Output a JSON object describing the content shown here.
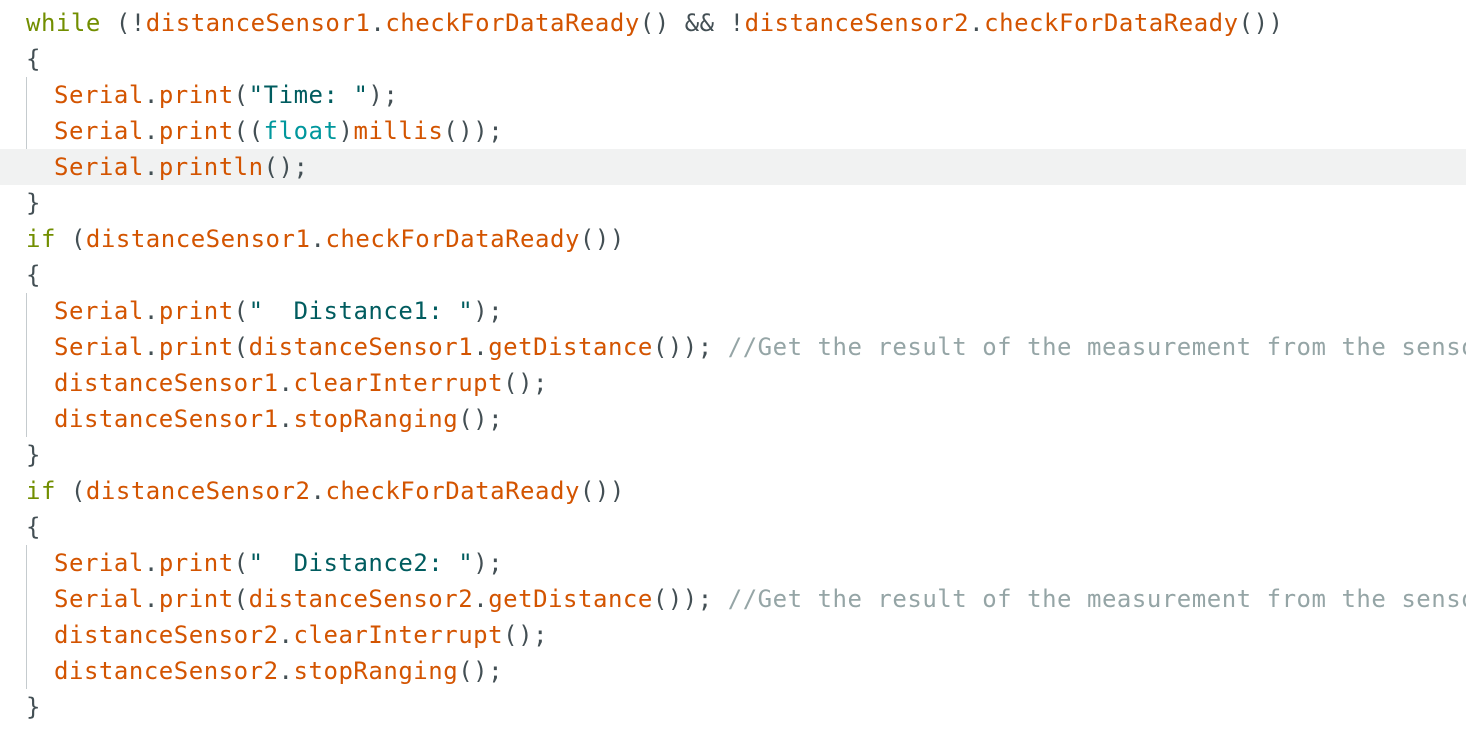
{
  "editor": {
    "language": "C++ (Arduino sketch)",
    "current_line_index": 4,
    "colors": {
      "background": "#ffffff",
      "current_line_highlight": "#f1f2f2",
      "indent_guide": "#c5cbce",
      "keyword": "#728e00",
      "function": "#d35400",
      "type": "#00979d",
      "string": "#005c5f",
      "comment": "#95a5a6",
      "punctuation": "#434f54"
    },
    "lines": [
      {
        "tokens": [
          {
            "t": "kw",
            "v": "while"
          },
          {
            "t": "pu",
            "v": " (!"
          },
          {
            "t": "fn",
            "v": "distanceSensor1"
          },
          {
            "t": "pu",
            "v": "."
          },
          {
            "t": "fn",
            "v": "checkForDataReady"
          },
          {
            "t": "pu",
            "v": "() && !"
          },
          {
            "t": "fn",
            "v": "distanceSensor2"
          },
          {
            "t": "pu",
            "v": "."
          },
          {
            "t": "fn",
            "v": "checkForDataReady"
          },
          {
            "t": "pu",
            "v": "())"
          }
        ]
      },
      {
        "tokens": [
          {
            "t": "pu",
            "v": "{"
          }
        ]
      },
      {
        "inner": true,
        "tokens": [
          {
            "t": "fn",
            "v": "Serial"
          },
          {
            "t": "pu",
            "v": "."
          },
          {
            "t": "fn",
            "v": "print"
          },
          {
            "t": "pu",
            "v": "("
          },
          {
            "t": "str",
            "v": "\"Time: \""
          },
          {
            "t": "pu",
            "v": ");"
          }
        ]
      },
      {
        "inner": true,
        "tokens": [
          {
            "t": "fn",
            "v": "Serial"
          },
          {
            "t": "pu",
            "v": "."
          },
          {
            "t": "fn",
            "v": "print"
          },
          {
            "t": "pu",
            "v": "(("
          },
          {
            "t": "ty",
            "v": "float"
          },
          {
            "t": "pu",
            "v": ")"
          },
          {
            "t": "fn",
            "v": "millis"
          },
          {
            "t": "pu",
            "v": "());"
          }
        ]
      },
      {
        "inner": true,
        "tokens": [
          {
            "t": "fn",
            "v": "Serial"
          },
          {
            "t": "pu",
            "v": "."
          },
          {
            "t": "fn",
            "v": "println"
          },
          {
            "t": "pu",
            "v": "();"
          }
        ]
      },
      {
        "tokens": [
          {
            "t": "pu",
            "v": "}"
          }
        ]
      },
      {
        "tokens": [
          {
            "t": "kw",
            "v": "if"
          },
          {
            "t": "pu",
            "v": " ("
          },
          {
            "t": "fn",
            "v": "distanceSensor1"
          },
          {
            "t": "pu",
            "v": "."
          },
          {
            "t": "fn",
            "v": "checkForDataReady"
          },
          {
            "t": "pu",
            "v": "())"
          }
        ]
      },
      {
        "tokens": [
          {
            "t": "pu",
            "v": "{"
          }
        ]
      },
      {
        "inner": true,
        "tokens": [
          {
            "t": "fn",
            "v": "Serial"
          },
          {
            "t": "pu",
            "v": "."
          },
          {
            "t": "fn",
            "v": "print"
          },
          {
            "t": "pu",
            "v": "("
          },
          {
            "t": "str",
            "v": "\"  Distance1: \""
          },
          {
            "t": "pu",
            "v": ");"
          }
        ]
      },
      {
        "inner": true,
        "tokens": [
          {
            "t": "fn",
            "v": "Serial"
          },
          {
            "t": "pu",
            "v": "."
          },
          {
            "t": "fn",
            "v": "print"
          },
          {
            "t": "pu",
            "v": "("
          },
          {
            "t": "fn",
            "v": "distanceSensor1"
          },
          {
            "t": "pu",
            "v": "."
          },
          {
            "t": "fn",
            "v": "getDistance"
          },
          {
            "t": "pu",
            "v": "()); "
          },
          {
            "t": "cm",
            "v": "//Get the result of the measurement from the sensor"
          }
        ]
      },
      {
        "inner": true,
        "tokens": [
          {
            "t": "fn",
            "v": "distanceSensor1"
          },
          {
            "t": "pu",
            "v": "."
          },
          {
            "t": "fn",
            "v": "clearInterrupt"
          },
          {
            "t": "pu",
            "v": "();"
          }
        ]
      },
      {
        "inner": true,
        "tokens": [
          {
            "t": "fn",
            "v": "distanceSensor1"
          },
          {
            "t": "pu",
            "v": "."
          },
          {
            "t": "fn",
            "v": "stopRanging"
          },
          {
            "t": "pu",
            "v": "();"
          }
        ]
      },
      {
        "tokens": [
          {
            "t": "pu",
            "v": "}"
          }
        ]
      },
      {
        "tokens": [
          {
            "t": "kw",
            "v": "if"
          },
          {
            "t": "pu",
            "v": " ("
          },
          {
            "t": "fn",
            "v": "distanceSensor2"
          },
          {
            "t": "pu",
            "v": "."
          },
          {
            "t": "fn",
            "v": "checkForDataReady"
          },
          {
            "t": "pu",
            "v": "())"
          }
        ]
      },
      {
        "tokens": [
          {
            "t": "pu",
            "v": "{"
          }
        ]
      },
      {
        "inner": true,
        "tokens": [
          {
            "t": "fn",
            "v": "Serial"
          },
          {
            "t": "pu",
            "v": "."
          },
          {
            "t": "fn",
            "v": "print"
          },
          {
            "t": "pu",
            "v": "("
          },
          {
            "t": "str",
            "v": "\"  Distance2: \""
          },
          {
            "t": "pu",
            "v": ");"
          }
        ]
      },
      {
        "inner": true,
        "tokens": [
          {
            "t": "fn",
            "v": "Serial"
          },
          {
            "t": "pu",
            "v": "."
          },
          {
            "t": "fn",
            "v": "print"
          },
          {
            "t": "pu",
            "v": "("
          },
          {
            "t": "fn",
            "v": "distanceSensor2"
          },
          {
            "t": "pu",
            "v": "."
          },
          {
            "t": "fn",
            "v": "getDistance"
          },
          {
            "t": "pu",
            "v": "()); "
          },
          {
            "t": "cm",
            "v": "//Get the result of the measurement from the sensor"
          }
        ]
      },
      {
        "inner": true,
        "tokens": [
          {
            "t": "fn",
            "v": "distanceSensor2"
          },
          {
            "t": "pu",
            "v": "."
          },
          {
            "t": "fn",
            "v": "clearInterrupt"
          },
          {
            "t": "pu",
            "v": "();"
          }
        ]
      },
      {
        "inner": true,
        "tokens": [
          {
            "t": "fn",
            "v": "distanceSensor2"
          },
          {
            "t": "pu",
            "v": "."
          },
          {
            "t": "fn",
            "v": "stopRanging"
          },
          {
            "t": "pu",
            "v": "();"
          }
        ]
      },
      {
        "tokens": [
          {
            "t": "pu",
            "v": "}"
          }
        ]
      }
    ]
  }
}
